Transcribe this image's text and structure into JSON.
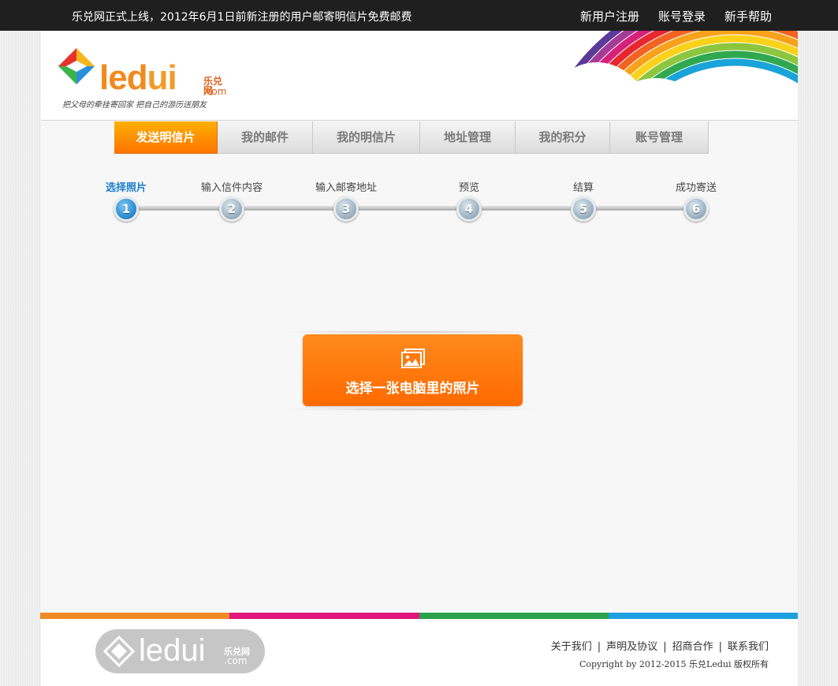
{
  "topbar": {
    "notice": "乐兑网正式上线，2012年6月1日前新注册的用户邮寄明信片免费邮费",
    "links": [
      "新用户注册",
      "账号登录",
      "新手帮助"
    ]
  },
  "header": {
    "logo_text_1": "led",
    "logo_text_2": "ui",
    "logo_sub": "乐兑网",
    "logo_com": ".com",
    "slogan": "把父母的牵挂寄回家  把自己的游历送朋友"
  },
  "nav": {
    "tabs": [
      {
        "label": "发送明信片",
        "active": true
      },
      {
        "label": "我的邮件",
        "active": false
      },
      {
        "label": "我的明信片",
        "active": false
      },
      {
        "label": "地址管理",
        "active": false
      },
      {
        "label": "我的积分",
        "active": false
      },
      {
        "label": "账号管理",
        "active": false
      }
    ]
  },
  "steps": [
    {
      "number": "1",
      "label": "选择照片",
      "active": true
    },
    {
      "number": "2",
      "label": "输入信件内容",
      "active": false
    },
    {
      "number": "3",
      "label": "输入邮寄地址",
      "active": false
    },
    {
      "number": "4",
      "label": "预览",
      "active": false
    },
    {
      "number": "5",
      "label": "结算",
      "active": false
    },
    {
      "number": "6",
      "label": "成功寄送",
      "active": false
    }
  ],
  "upload": {
    "label": "选择一张电脑里的照片",
    "icon": "image-icon"
  },
  "colors": {
    "accent": "#ff7400",
    "active_step": "#1a7ecf",
    "colorbar": [
      "#f08a24",
      "#e3157c",
      "#2aa14b",
      "#1ea0e0"
    ]
  },
  "footer": {
    "logo_text": "ledui",
    "logo_sub": "乐兑网",
    "logo_com": ".com",
    "links": [
      "关于我们",
      "声明及协议",
      "招商合作",
      "联系我们"
    ],
    "copyright": "Copyright by 2012-2015 乐兑Ledui 版权所有"
  }
}
